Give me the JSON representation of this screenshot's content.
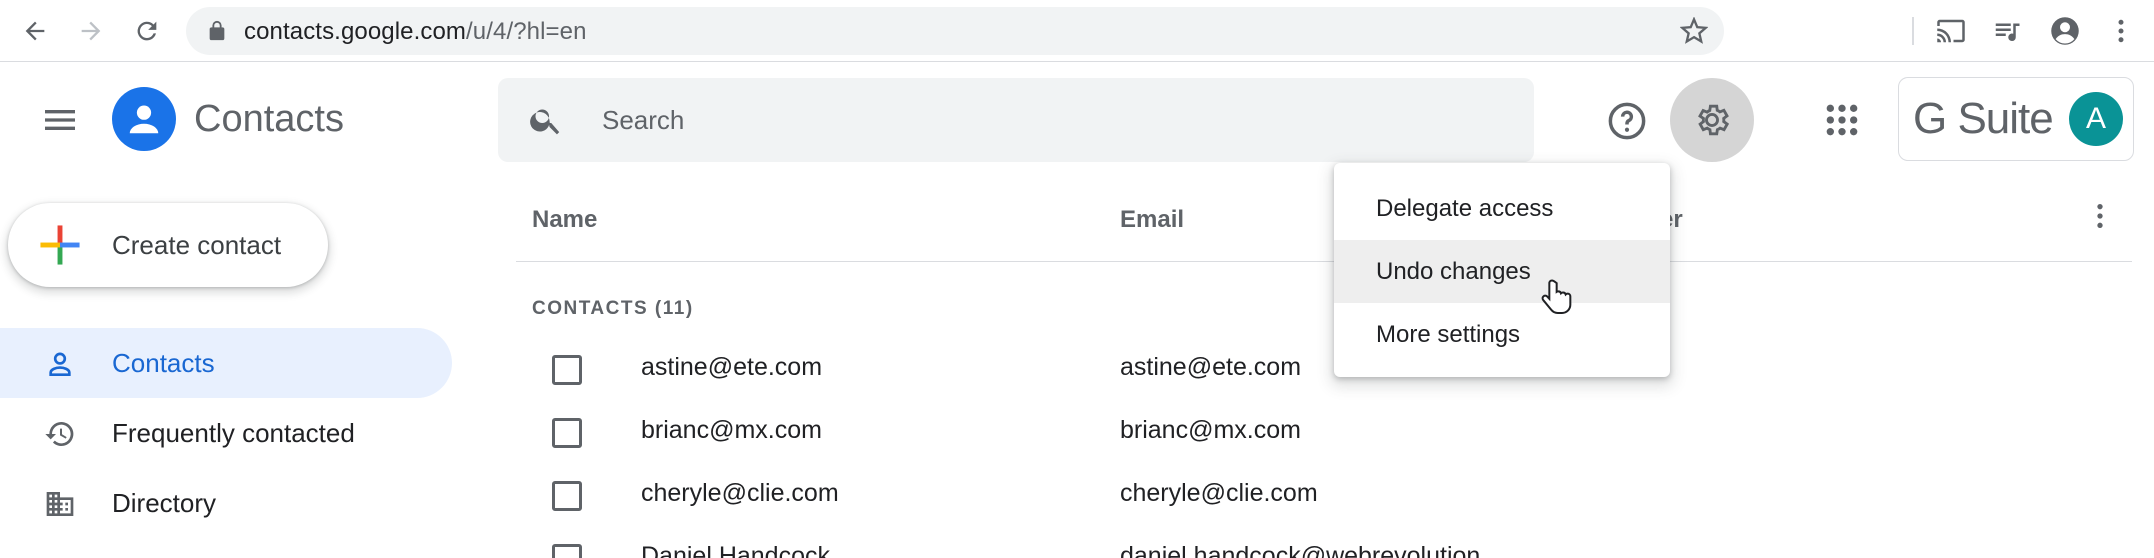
{
  "browser": {
    "url_host": "contacts.google.com",
    "url_path": "/u/4/?hl=en"
  },
  "app": {
    "title": "Contacts",
    "brand": "G Suite",
    "avatar_letter": "A",
    "accent_color": "#1a73e8"
  },
  "search": {
    "placeholder": "Search"
  },
  "sidebar": {
    "create_label": "Create contact",
    "items": [
      {
        "label": "Contacts",
        "icon": "person-icon",
        "active": true
      },
      {
        "label": "Frequently contacted",
        "icon": "history-icon",
        "active": false
      },
      {
        "label": "Directory",
        "icon": "building-icon",
        "active": false
      }
    ]
  },
  "table": {
    "columns": {
      "name": "Name",
      "email": "Email",
      "third_partial": "er"
    },
    "section_label": "CONTACTS (11)",
    "rows": [
      {
        "name": "astine@ete.com",
        "email": "astine@ete.com"
      },
      {
        "name": "brianc@mx.com",
        "email": "brianc@mx.com"
      },
      {
        "name": "cheryle@clie.com",
        "email": "cheryle@clie.com"
      },
      {
        "name": "Daniel Handcock",
        "email": "daniel.handcock@webrevolution"
      }
    ]
  },
  "settings_menu": {
    "items": [
      {
        "label": "Delegate access"
      },
      {
        "label": "Undo changes"
      },
      {
        "label": "More settings"
      }
    ]
  }
}
